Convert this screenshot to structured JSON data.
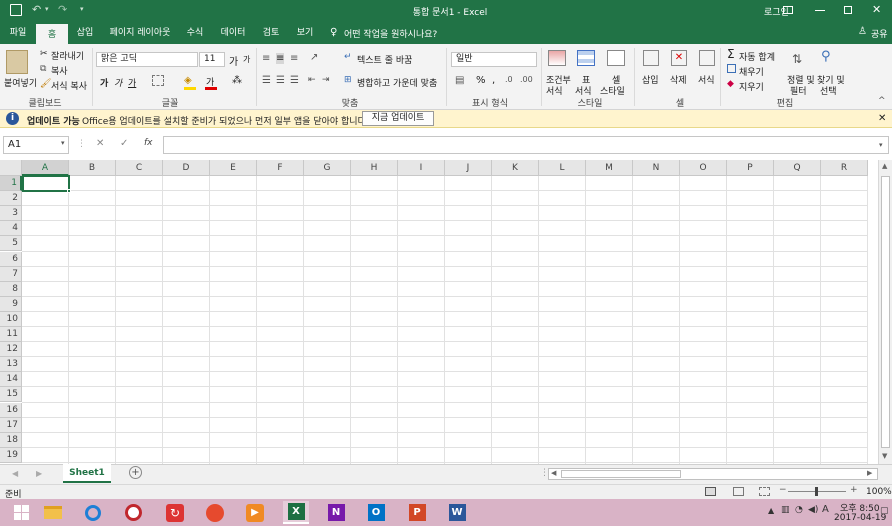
{
  "window": {
    "title": "통합 문서1  -  Excel",
    "signin": "로그인",
    "share": "공유"
  },
  "tabs": [
    "파일",
    "홈",
    "삽입",
    "페이지 레이아웃",
    "수식",
    "데이터",
    "검토",
    "보기"
  ],
  "tell_me": "어떤 작업을 원하시나요?",
  "ribbon": {
    "clipboard": {
      "paste": "붙여넣기",
      "cut": "잘라내기",
      "copy": "복사",
      "format_painter": "서식 복사",
      "label": "클립보드"
    },
    "font": {
      "name": "맑은 고딕",
      "size": "11",
      "grow": "가",
      "shrink": "가",
      "bold": "가",
      "italic": "가",
      "underline": "가",
      "color_a": "가",
      "label": "글꼴"
    },
    "align": {
      "wrap": "텍스트 줄 바꿈",
      "merge": "병합하고 가운데 맞춤",
      "label": "맞춤"
    },
    "number": {
      "format": "일반",
      "percent": "%",
      "comma": ",",
      "label": "표시 형식"
    },
    "styles": {
      "cond1": "조건부",
      "cond2": "서식",
      "table1": "표",
      "table2": "서식",
      "cell1": "셀",
      "cell2": "스타일",
      "label": "스타일"
    },
    "cells": {
      "insert": "삽입",
      "delete": "삭제",
      "format": "서식",
      "label": "셀"
    },
    "editing": {
      "autosum": "자동 합계",
      "fill": "채우기",
      "clear": "지우기",
      "sort1": "정렬 및",
      "sort2": "필터",
      "find1": "찾기 및",
      "find2": "선택",
      "label": "편집"
    }
  },
  "message": {
    "title": "업데이트 가능",
    "text": "Office용 업데이트를 설치할 준비가 되었으나 먼저 일부 앱을 닫아야 합니다.",
    "button": "지금 업데이트"
  },
  "formula": {
    "name_box": "A1",
    "fx": "fx",
    "content": ""
  },
  "columns": [
    "A",
    "B",
    "C",
    "D",
    "E",
    "F",
    "G",
    "H",
    "I",
    "J",
    "K",
    "L",
    "M",
    "N",
    "O",
    "P",
    "Q",
    "R"
  ],
  "rows": [
    "1",
    "2",
    "3",
    "4",
    "5",
    "6",
    "7",
    "8",
    "9",
    "10",
    "11",
    "12",
    "13",
    "14",
    "15",
    "16",
    "17",
    "18",
    "19"
  ],
  "sheet_tab": "Sheet1",
  "status": {
    "ready": "준비",
    "zoom": "100%"
  },
  "clock": {
    "time": "오후 8:50",
    "date": "2017-04-19"
  },
  "colors": {
    "brand": "#217346",
    "taskbar": "#d9b3c6"
  },
  "taskbar_icons": [
    "windows-icon",
    "file-explorer-icon",
    "edge-icon",
    "app-red-icon",
    "app-sync-icon",
    "camera-app-icon",
    "media-player-icon",
    "excel-icon",
    "onenote-icon",
    "outlook-icon",
    "powerpoint-icon",
    "word-icon"
  ]
}
